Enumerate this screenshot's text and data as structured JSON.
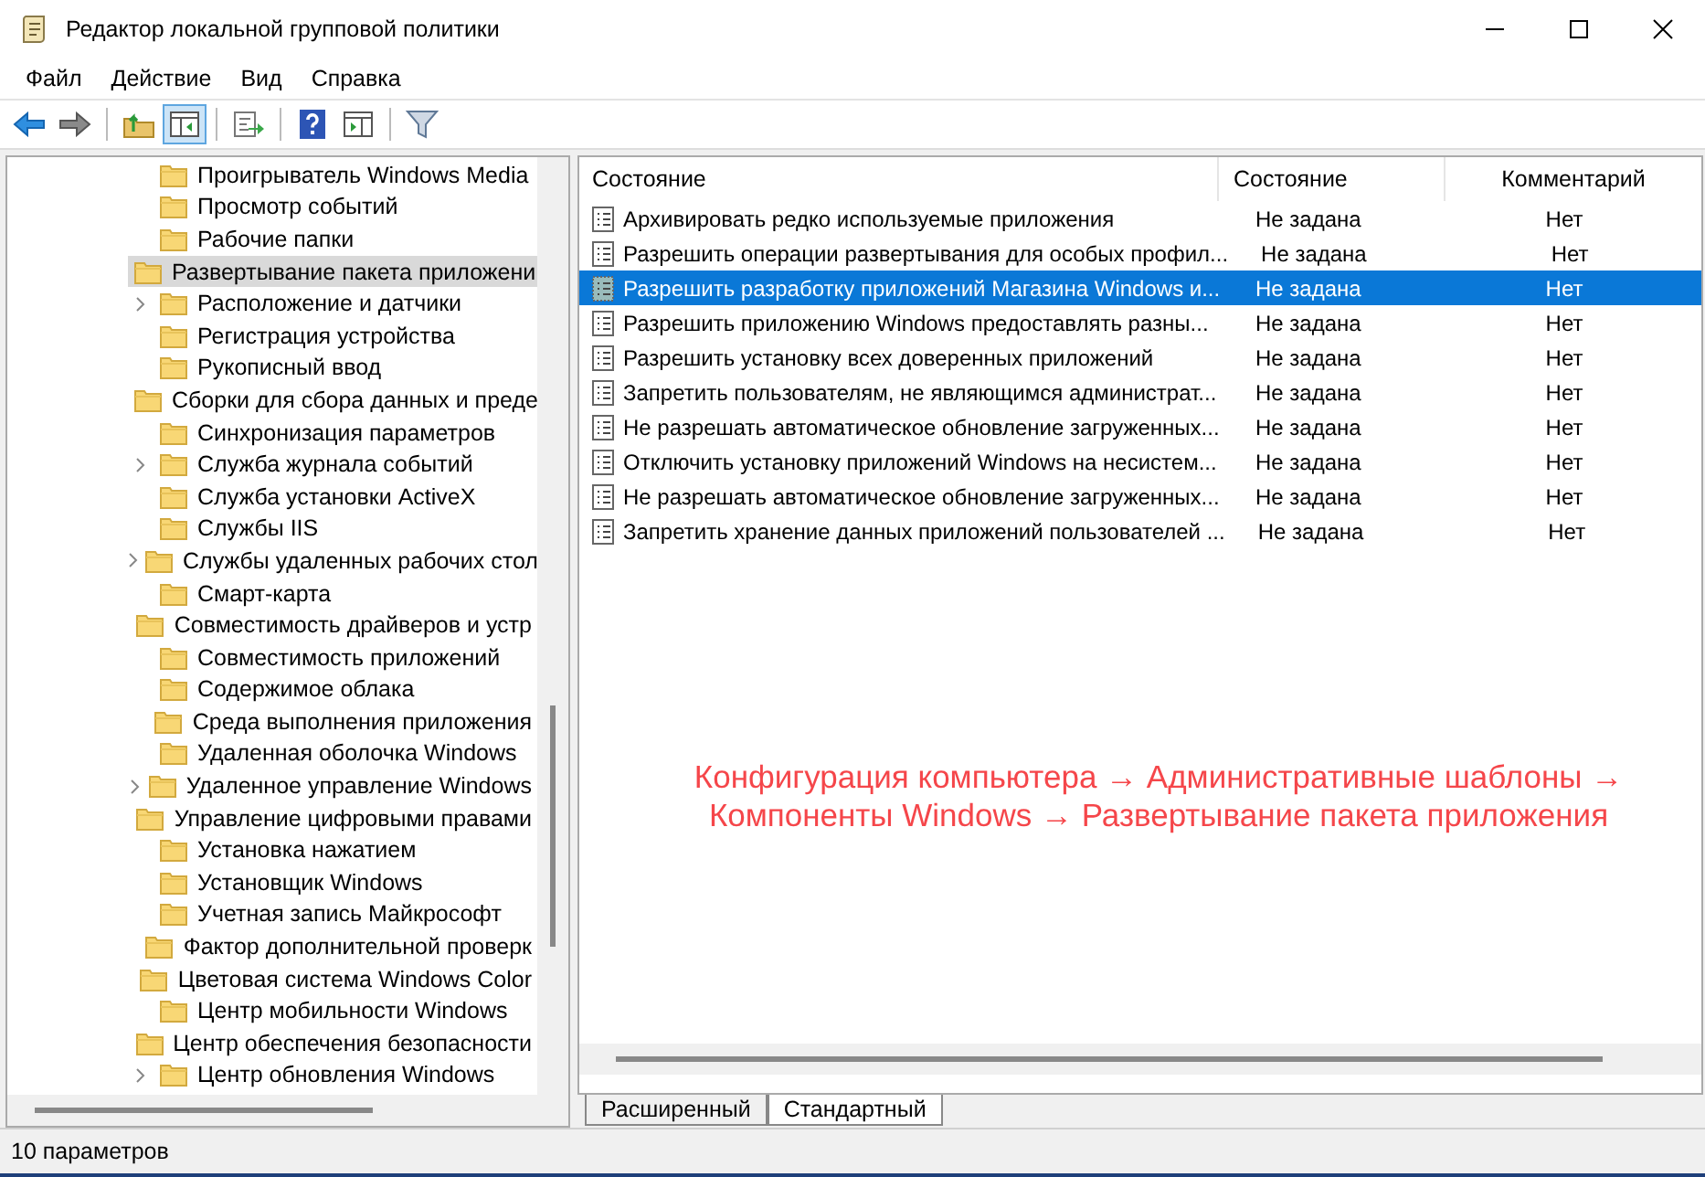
{
  "window": {
    "title": "Редактор локальной групповой политики"
  },
  "menu": [
    "Файл",
    "Действие",
    "Вид",
    "Справка"
  ],
  "toolbar": [
    [
      {
        "kind": "back",
        "pressed": false
      },
      {
        "kind": "forward",
        "pressed": false
      }
    ],
    [
      {
        "kind": "up",
        "pressed": false
      },
      {
        "kind": "tree",
        "pressed": true
      }
    ],
    [
      {
        "kind": "export",
        "pressed": false
      }
    ],
    [
      {
        "kind": "help",
        "pressed": false
      },
      {
        "kind": "pane",
        "pressed": false
      }
    ],
    [
      {
        "kind": "filter",
        "pressed": false
      }
    ]
  ],
  "tree": {
    "items": [
      {
        "label": "Проигрыватель Windows Media",
        "has_children": false,
        "selected": false
      },
      {
        "label": "Просмотр событий",
        "has_children": false,
        "selected": false
      },
      {
        "label": "Рабочие папки",
        "has_children": false,
        "selected": false
      },
      {
        "label": "Развертывание пакета приложени",
        "has_children": false,
        "selected": true
      },
      {
        "label": "Расположение и датчики",
        "has_children": true,
        "selected": false
      },
      {
        "label": "Регистрация устройства",
        "has_children": false,
        "selected": false
      },
      {
        "label": "Рукописный ввод",
        "has_children": false,
        "selected": false
      },
      {
        "label": "Сборки для сбора данных и преде",
        "has_children": false,
        "selected": false
      },
      {
        "label": "Синхронизация параметров",
        "has_children": false,
        "selected": false
      },
      {
        "label": "Служба журнала событий",
        "has_children": true,
        "selected": false
      },
      {
        "label": "Служба установки ActiveX",
        "has_children": false,
        "selected": false
      },
      {
        "label": "Службы IIS",
        "has_children": false,
        "selected": false
      },
      {
        "label": "Службы удаленных рабочих стол",
        "has_children": true,
        "selected": false
      },
      {
        "label": "Смарт-карта",
        "has_children": false,
        "selected": false
      },
      {
        "label": "Совместимость драйверов и устр",
        "has_children": false,
        "selected": false
      },
      {
        "label": "Совместимость приложений",
        "has_children": false,
        "selected": false
      },
      {
        "label": "Содержимое облака",
        "has_children": false,
        "selected": false
      },
      {
        "label": "Среда выполнения приложения",
        "has_children": false,
        "selected": false
      },
      {
        "label": "Удаленная оболочка Windows",
        "has_children": false,
        "selected": false
      },
      {
        "label": "Удаленное управление Windows",
        "has_children": true,
        "selected": false
      },
      {
        "label": "Управление цифровыми правами",
        "has_children": false,
        "selected": false
      },
      {
        "label": "Установка нажатием",
        "has_children": false,
        "selected": false
      },
      {
        "label": "Установщик Windows",
        "has_children": false,
        "selected": false
      },
      {
        "label": "Учетная запись Майкрософт",
        "has_children": false,
        "selected": false
      },
      {
        "label": "Фактор дополнительной проверк",
        "has_children": false,
        "selected": false
      },
      {
        "label": "Цветовая система Windows Color",
        "has_children": false,
        "selected": false
      },
      {
        "label": "Центр мобильности Windows",
        "has_children": false,
        "selected": false
      },
      {
        "label": "Центр обеспечения безопасности",
        "has_children": false,
        "selected": false
      },
      {
        "label": "Центр обновления Windows",
        "has_children": true,
        "selected": false
      }
    ]
  },
  "table": {
    "columns": [
      "Состояние",
      "Состояние",
      "Комментарий"
    ],
    "rows": [
      {
        "name": "Архивировать редко используемые приложения",
        "state": "Не задана",
        "comment": "Нет",
        "selected": false
      },
      {
        "name": "Разрешить операции развертывания для особых профил...",
        "state": "Не задана",
        "comment": "Нет",
        "selected": false
      },
      {
        "name": "Разрешить разработку приложений Магазина Windows и...",
        "state": "Не задана",
        "comment": "Нет",
        "selected": true
      },
      {
        "name": "Разрешить приложению Windows предоставлять разны...",
        "state": "Не задана",
        "comment": "Нет",
        "selected": false
      },
      {
        "name": "Разрешить установку всех доверенных приложений",
        "state": "Не задана",
        "comment": "Нет",
        "selected": false
      },
      {
        "name": "Запретить пользователям, не являющимся администрат...",
        "state": "Не задана",
        "comment": "Нет",
        "selected": false
      },
      {
        "name": "Не разрешать автоматическое обновление загруженных...",
        "state": "Не задана",
        "comment": "Нет",
        "selected": false
      },
      {
        "name": "Отключить установку приложений Windows на несистем...",
        "state": "Не задана",
        "comment": "Нет",
        "selected": false
      },
      {
        "name": "Не разрешать автоматическое обновление загруженных...",
        "state": "Не задана",
        "comment": "Нет",
        "selected": false
      },
      {
        "name": "Запретить хранение данных приложений пользователей ...",
        "state": "Не задана",
        "comment": "Нет",
        "selected": false
      }
    ]
  },
  "annotation": {
    "lines": [
      "Конфигурация компьютера → Административные шаблоны →",
      "Компоненты Windows → Развертывание пакета приложения"
    ]
  },
  "tabs": [
    {
      "label": "Расширенный",
      "selected": false
    },
    {
      "label": "Стандартный",
      "selected": true
    }
  ],
  "status_bar": "10 параметров"
}
